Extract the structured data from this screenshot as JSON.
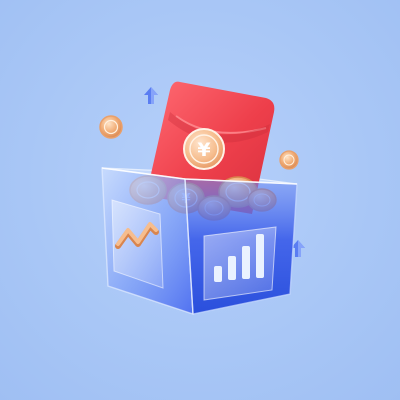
{
  "illustration": {
    "subject": "3d-red-envelope-in-glass-box",
    "icons": [
      "up-arrow-icon",
      "red-envelope-icon",
      "yuan-coin-icon",
      "line-chart-icon",
      "bar-chart-icon"
    ],
    "symbols": {
      "currency": "¥"
    },
    "colors": {
      "background": "#a8c6f6",
      "envelope_red": "#ee3f4b",
      "envelope_dark": "#c82c3a",
      "coin_gold": "#f2b07b",
      "coin_dark": "#d9854e",
      "box_blue": "#3f67ee",
      "box_glass": "#8fb0ff",
      "accent_light": "#eaf2ff"
    }
  }
}
